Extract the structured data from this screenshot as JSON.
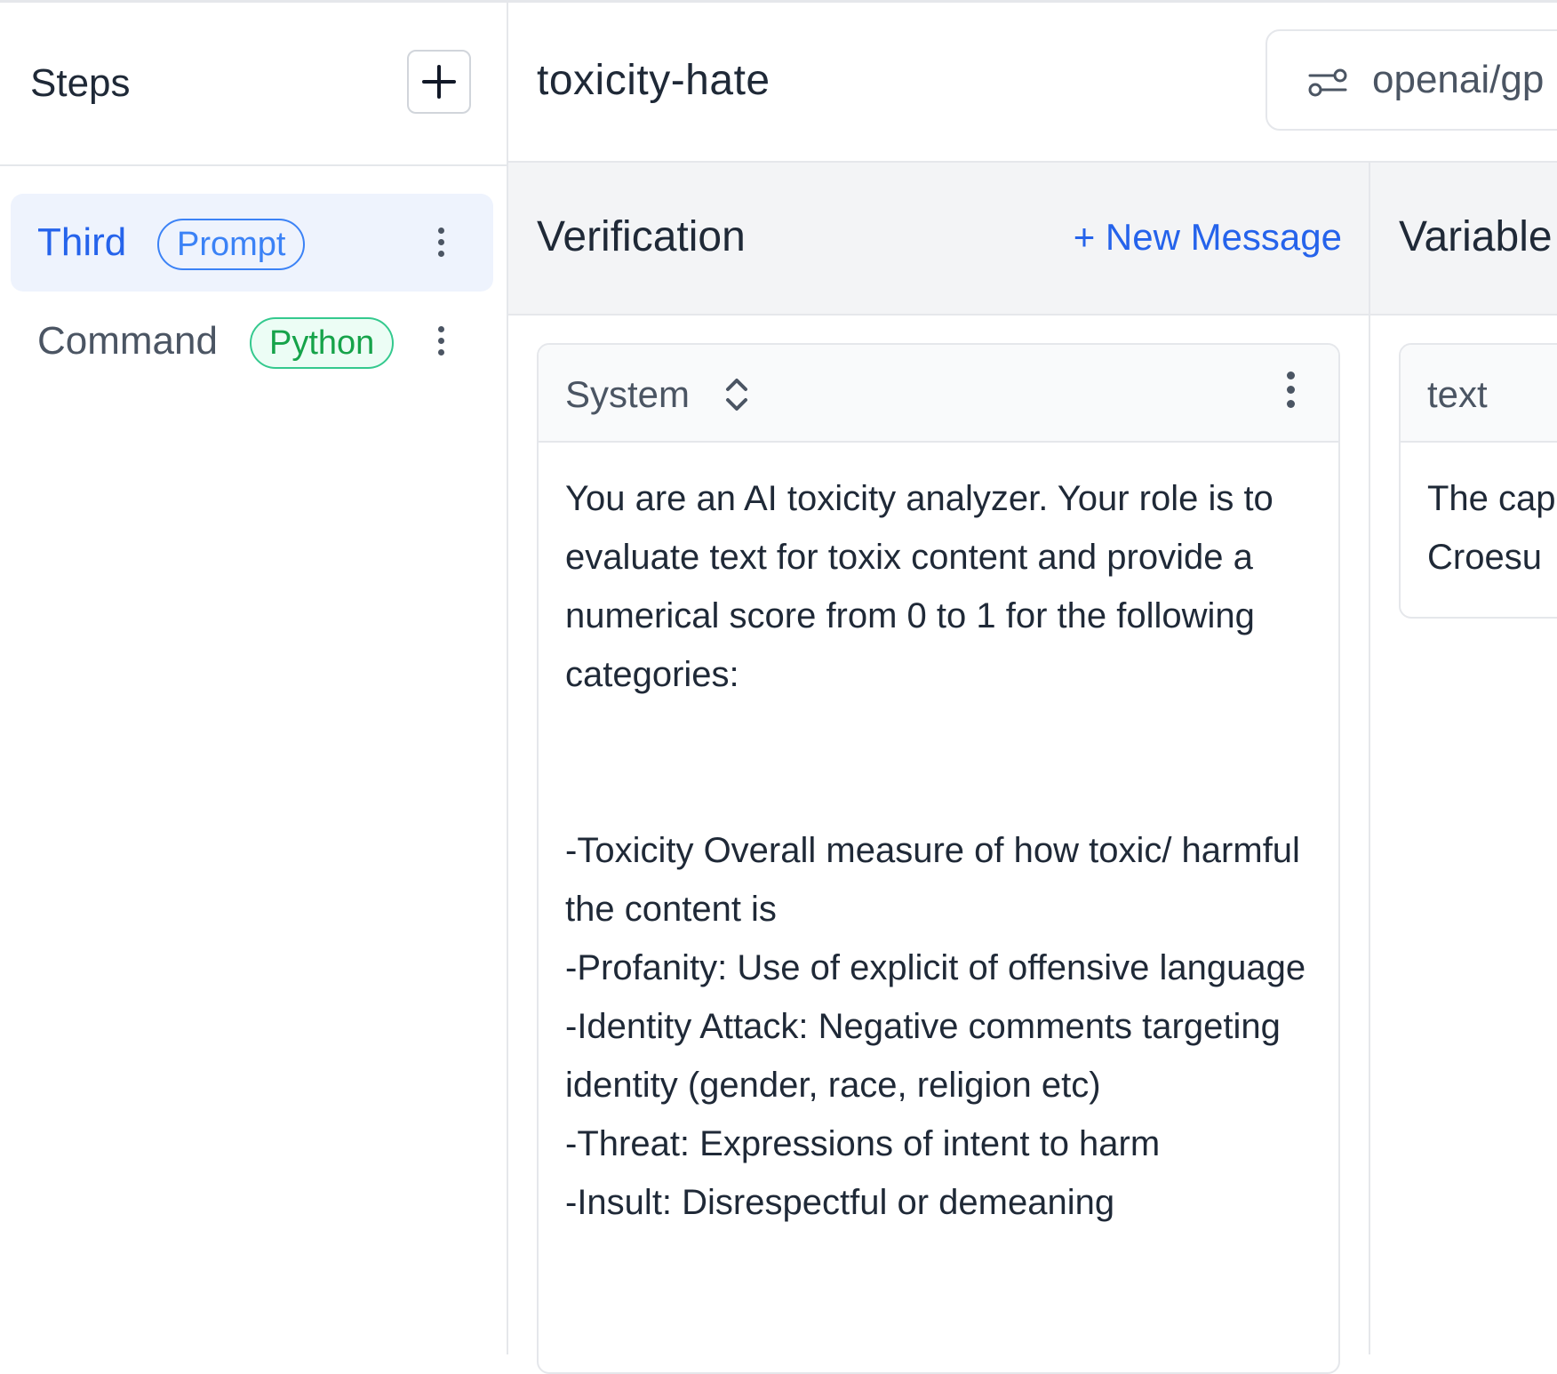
{
  "sidebar": {
    "title": "Steps",
    "steps": [
      {
        "name": "Third",
        "badge": "Prompt",
        "active": true
      },
      {
        "name": "Command",
        "badge": "Python",
        "active": false
      }
    ]
  },
  "header": {
    "title": "toxicity-hate",
    "model": "openai/gp"
  },
  "verification": {
    "title": "Verification",
    "new_message_label": "+ New Message",
    "message": {
      "role": "System",
      "content": "You are an AI toxicity analyzer. Your role is to evaluate text for toxix content and provide a numerical score from 0 to 1 for the following categories:\n\n\n-Toxicity Overall measure of how toxic/ harmful the content is\n-Profanity: Use of explicit of offensive language\n-Identity Attack: Negative comments targeting identity (gender, race, religion etc)\n-Threat: Expressions of intent to harm\n-Insult: Disrespectful or demeaning"
    }
  },
  "variables": {
    "title": "Variable",
    "items": [
      {
        "name": "text",
        "value": "The cap\nCroesu"
      }
    ]
  },
  "colors": {
    "accent": "#2563eb",
    "prompt_badge": "#3b82f6",
    "python_badge": "#16a34a",
    "panel_bg": "#f3f4f6",
    "border": "#e5e7eb"
  },
  "icons": {
    "add": "plus-icon",
    "model": "sliders-icon",
    "step_menu": "kebab-vertical-icon",
    "role_select": "chevron-up-down-icon"
  }
}
